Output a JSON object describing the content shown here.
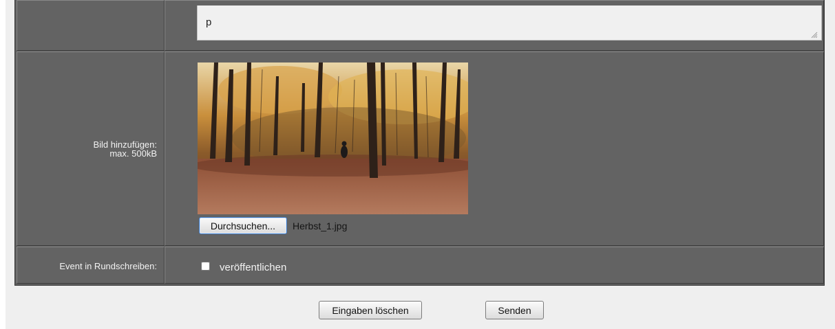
{
  "description": {
    "value": "p"
  },
  "image_upload": {
    "label_line1": "Bild hinzufügen:",
    "label_line2": "max. 500kB",
    "preview_alt": "autumn forest photo preview",
    "browse_label": "Durchsuchen...",
    "file_name": "Herbst_1.jpg"
  },
  "newsletter": {
    "label": "Event in Rundschreiben:",
    "checkbox_label": "veröffentlichen",
    "checked": false
  },
  "actions": {
    "reset_label": "Eingaben löschen",
    "submit_label": "Senden"
  }
}
